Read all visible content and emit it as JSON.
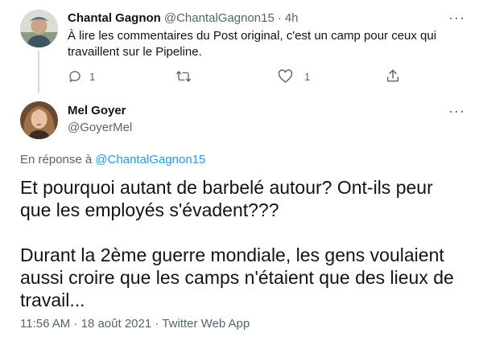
{
  "parent_tweet": {
    "author_name": "Chantal Gagnon",
    "author_handle": "@ChantalGagnon15",
    "separator": "·",
    "time": "4h",
    "text_lines": [
      "À lire les commentaires du Post original, c'est un camp pour ceux qui",
      "travaillent sur le Pipeline."
    ],
    "reply_count": "1",
    "like_count": "1",
    "more_menu": "···"
  },
  "main_tweet": {
    "author_name": "Mel Goyer",
    "author_handle": "@GoyerMel",
    "more_menu": "···",
    "reply_prefix": "En réponse à",
    "reply_to": "@ChantalGagnon15",
    "paragraph1_lines": [
      "Et pourquoi autant de barbelé autour? Ont-ils peur",
      "que les employés s'évadent???"
    ],
    "paragraph2_lines": [
      "Durant la 2ème guerre mondiale, les gens voulaient",
      "aussi croire que les camps n'étaient que des lieux de",
      "travail..."
    ],
    "time": "11:56 AM",
    "date": "18 août 2021",
    "source": "Twitter Web App",
    "meta_separator": "·"
  },
  "icons": {
    "reply": "reply-icon",
    "retweet": "retweet-icon",
    "like": "heart-icon",
    "share": "share-icon",
    "more": "more-icon"
  },
  "colors": {
    "accent": "#1d9bf0",
    "muted": "#536471",
    "text": "#0f1419",
    "thread_line": "#cfd9de"
  }
}
